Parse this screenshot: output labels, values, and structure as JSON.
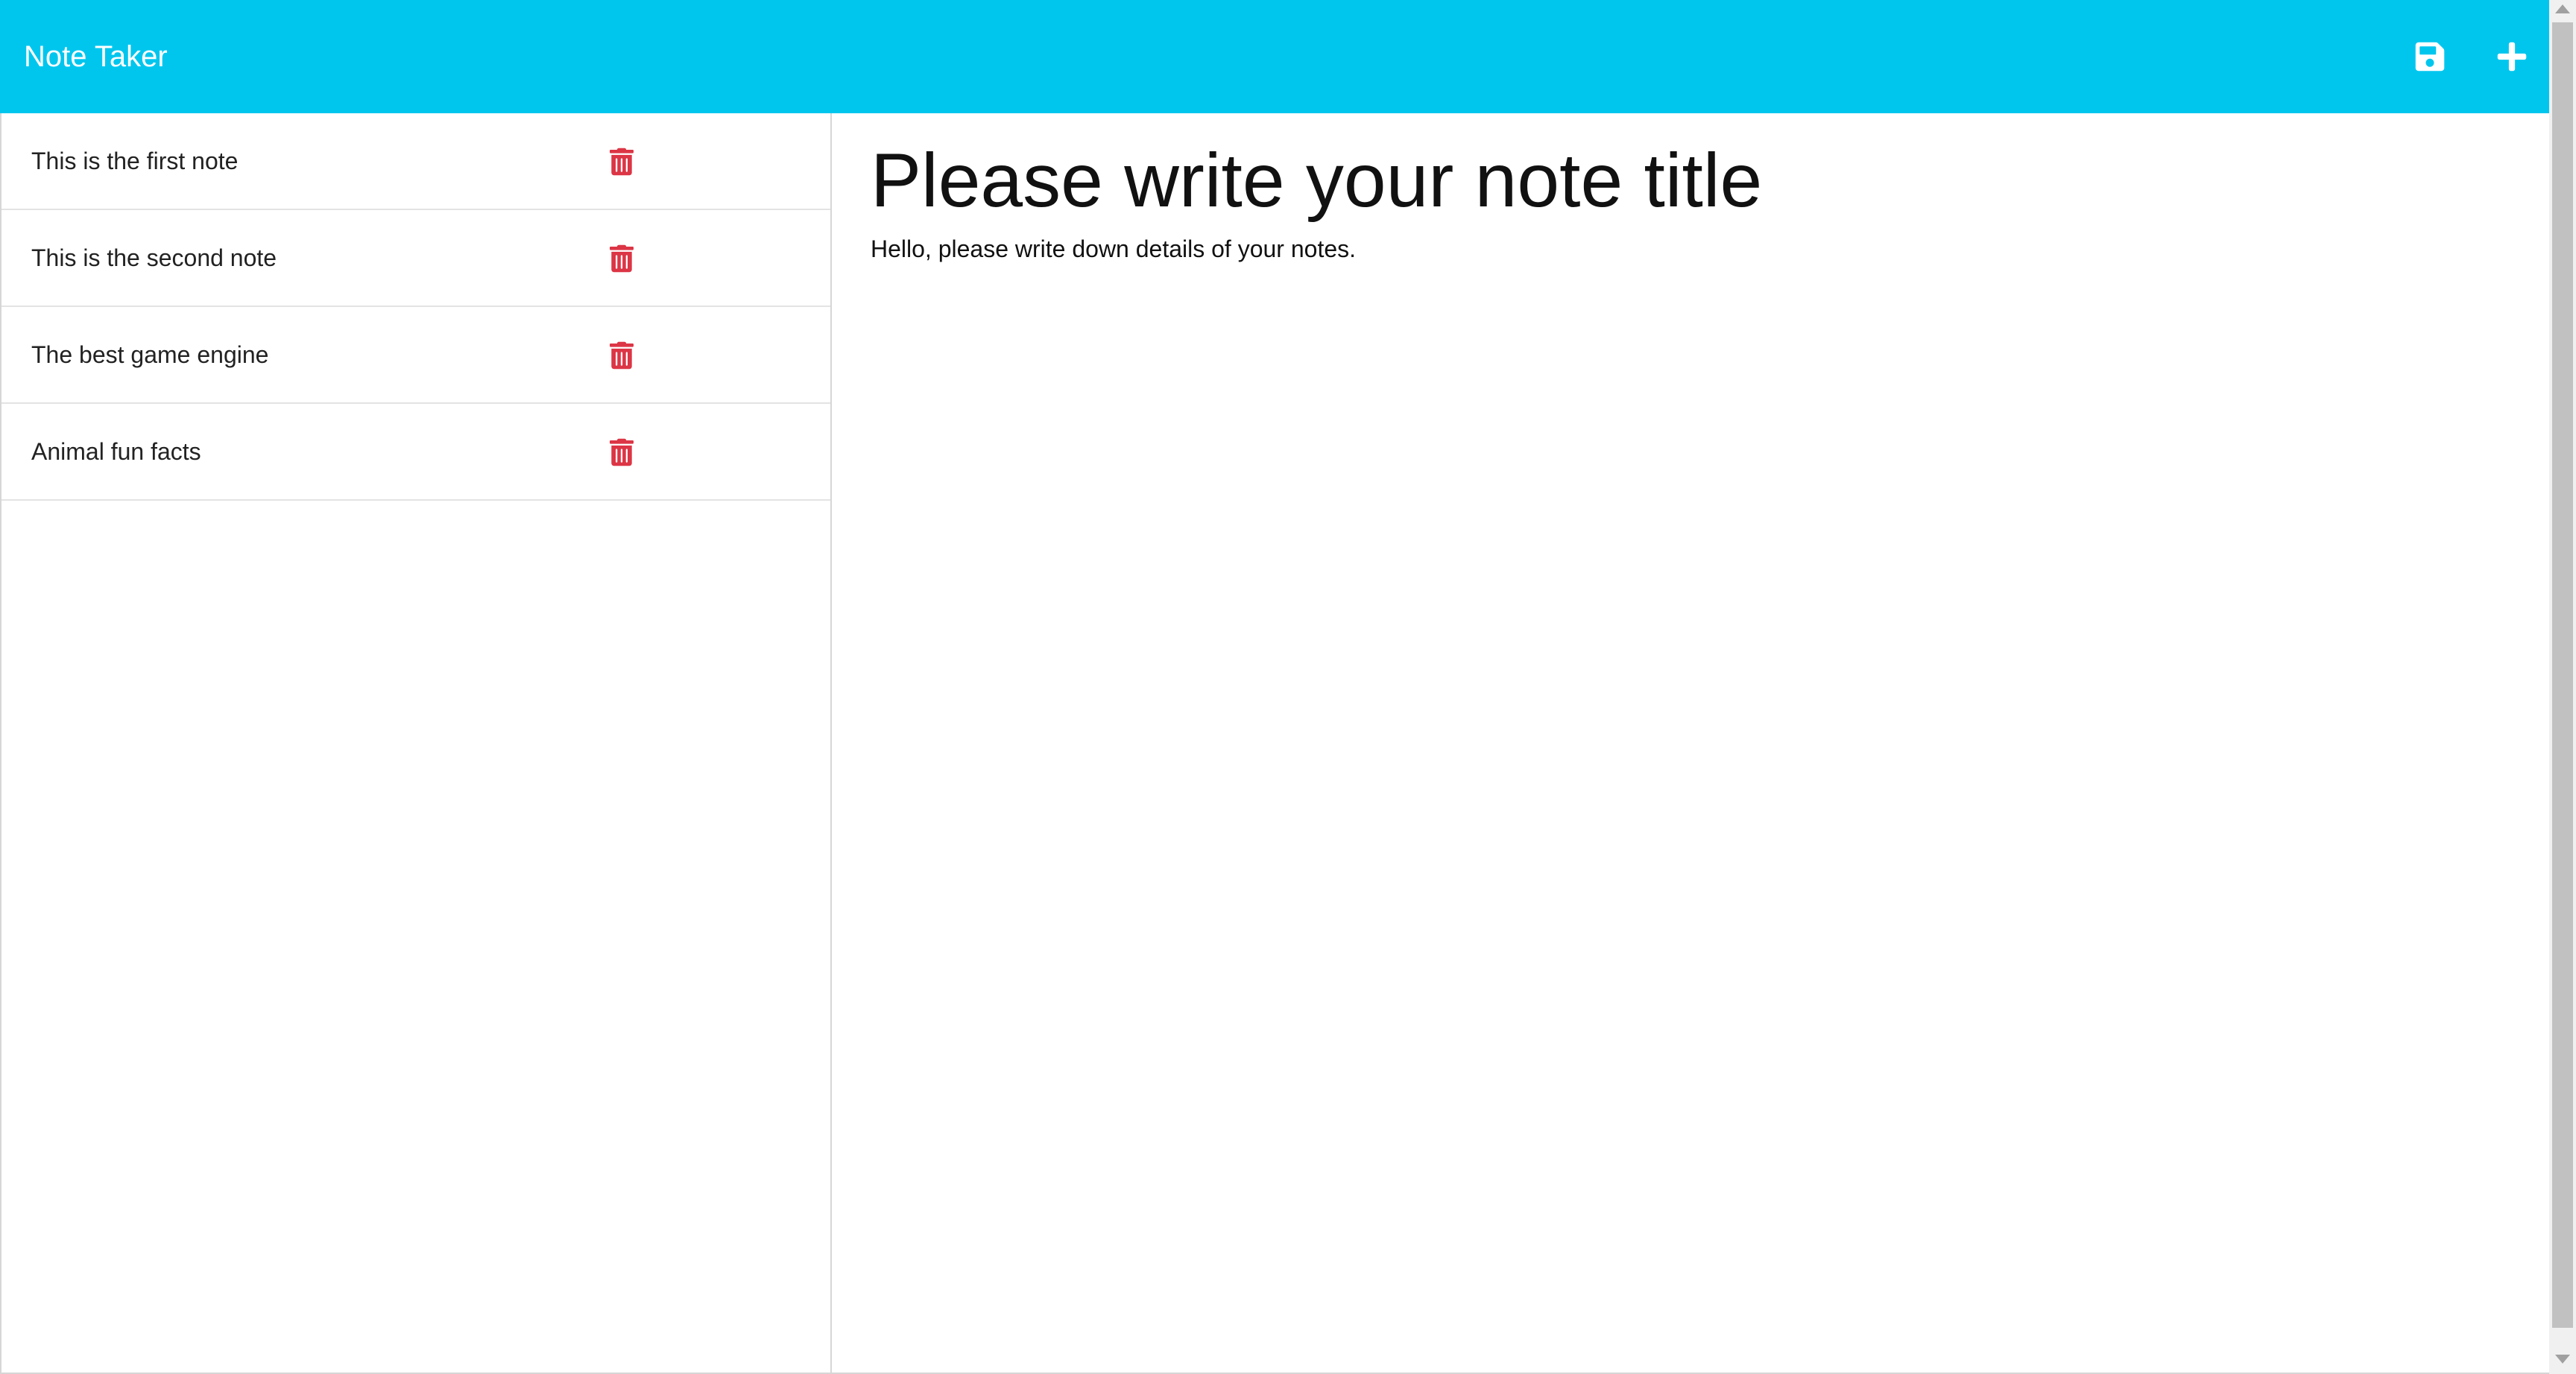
{
  "app": {
    "brand": "Note Taker"
  },
  "toolbar": {
    "save_icon": "save-icon",
    "new_icon": "plus-icon"
  },
  "notes": [
    {
      "title": "This is the first note"
    },
    {
      "title": "This is the second note"
    },
    {
      "title": "The best game engine"
    },
    {
      "title": "Animal fun facts"
    }
  ],
  "editor": {
    "title_placeholder": "Please write your note title",
    "body_placeholder": "Hello, please write down details of your notes."
  },
  "colors": {
    "navbar": "#00c6ee",
    "delete": "#dc3545",
    "nav_icon": "#ffffff"
  }
}
